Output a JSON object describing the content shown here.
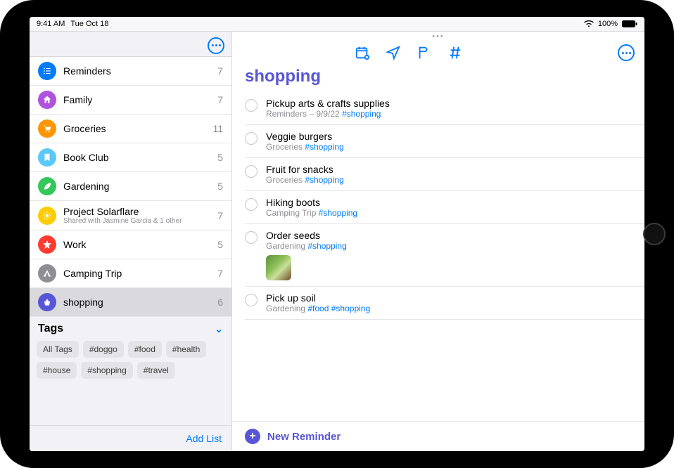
{
  "status": {
    "time": "9:41 AM",
    "date": "Tue Oct 18",
    "battery": "100%"
  },
  "sidebar": {
    "lists": [
      {
        "name": "Reminders",
        "count": "7",
        "color": "#007aff",
        "icon": "list"
      },
      {
        "name": "Family",
        "count": "7",
        "color": "#af52de",
        "icon": "home"
      },
      {
        "name": "Groceries",
        "count": "11",
        "color": "#ff9500",
        "icon": "cart"
      },
      {
        "name": "Book Club",
        "count": "5",
        "color": "#5ac8fa",
        "icon": "bookmark"
      },
      {
        "name": "Gardening",
        "count": "5",
        "color": "#34c759",
        "icon": "leaf"
      },
      {
        "name": "Project Solarflare",
        "sub": "Shared with Jasmine Garcia & 1 other",
        "count": "7",
        "color": "#ffcc00",
        "icon": "sun"
      },
      {
        "name": "Work",
        "count": "5",
        "color": "#ff3b30",
        "icon": "star"
      },
      {
        "name": "Camping Trip",
        "count": "7",
        "color": "#8e8e93",
        "icon": "tent"
      },
      {
        "name": "shopping",
        "count": "6",
        "color": "#5856d6",
        "icon": "basket",
        "selected": true
      }
    ],
    "tags_header": "Tags",
    "tags": [
      "All Tags",
      "#doggo",
      "#food",
      "#health",
      "#house",
      "#shopping",
      "#travel"
    ],
    "add_list": "Add List"
  },
  "main": {
    "title": "shopping",
    "reminders": [
      {
        "title": "Pickup arts & crafts supplies",
        "sub_prefix": "Reminders – 9/9/22 ",
        "tags": [
          "#shopping"
        ]
      },
      {
        "title": "Veggie burgers",
        "sub_prefix": "Groceries ",
        "tags": [
          "#shopping"
        ]
      },
      {
        "title": "Fruit for snacks",
        "sub_prefix": "Groceries ",
        "tags": [
          "#shopping"
        ]
      },
      {
        "title": "Hiking boots",
        "sub_prefix": "Camping Trip ",
        "tags": [
          "#shopping"
        ]
      },
      {
        "title": "Order seeds",
        "sub_prefix": "Gardening ",
        "tags": [
          "#shopping"
        ],
        "has_image": true
      },
      {
        "title": "Pick up soil",
        "sub_prefix": "Gardening ",
        "tags": [
          "#food",
          "#shopping"
        ]
      }
    ],
    "new_reminder": "New Reminder"
  }
}
